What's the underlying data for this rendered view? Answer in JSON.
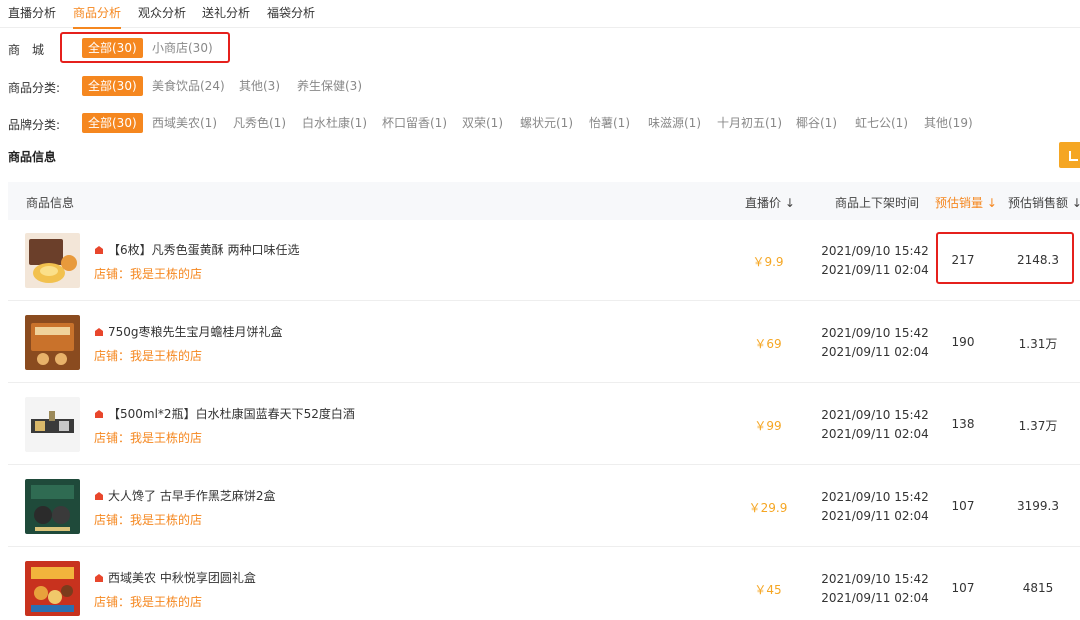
{
  "tabs": [
    {
      "label": "直播分析",
      "active": false
    },
    {
      "label": "商品分析",
      "active": true
    },
    {
      "label": "观众分析",
      "active": false
    },
    {
      "label": "送礼分析",
      "active": false
    },
    {
      "label": "福袋分析",
      "active": false
    }
  ],
  "filters": {
    "mall": {
      "label": "商　城",
      "chips": [
        "全部(30)",
        "小商店(30)"
      ]
    },
    "category": {
      "label": "商品分类:",
      "chips": [
        "全部(30)",
        "美食饮品(24)",
        "其他(3)",
        "养生保健(3)"
      ]
    },
    "brand": {
      "label": "品牌分类:",
      "chips": [
        "全部(30)",
        "西域美农(1)",
        "凡秀色(1)",
        "白水杜康(1)",
        "杯口留香(1)",
        "双荣(1)",
        "螺状元(1)",
        "怡薯(1)",
        "味滋源(1)",
        "十月初五(1)",
        "椰谷(1)",
        "虹七公(1)",
        "其他(19)"
      ]
    }
  },
  "section_title": "商品信息",
  "table": {
    "headers": {
      "info": "商品信息",
      "price": "直播价 ↓",
      "time": "商品上下架时间",
      "sales": "预估销量 ↓",
      "amount": "预估销售额 ↓"
    },
    "rows": [
      {
        "title": "【6枚】凡秀色蛋黄酥 两种口味任选",
        "shop": "店铺：我是王栋的店",
        "price": "￥9.9",
        "time_on": "2021/09/10 15:42",
        "time_off": "2021/09/11 02:04",
        "sales": "217",
        "amount": "2148.3"
      },
      {
        "title": "750g枣粮先生宝月蟾桂月饼礼盒",
        "shop": "店铺：我是王栋的店",
        "price": "￥69",
        "time_on": "2021/09/10 15:42",
        "time_off": "2021/09/11 02:04",
        "sales": "190",
        "amount": "1.31万"
      },
      {
        "title": "【500ml*2瓶】白水杜康国蓝春天下52度白酒",
        "shop": "店铺：我是王栋的店",
        "price": "￥99",
        "time_on": "2021/09/10 15:42",
        "time_off": "2021/09/11 02:04",
        "sales": "138",
        "amount": "1.37万"
      },
      {
        "title": "大人馋了 古早手作黑芝麻饼2盒",
        "shop": "店铺：我是王栋的店",
        "price": "￥29.9",
        "time_on": "2021/09/10 15:42",
        "time_off": "2021/09/11 02:04",
        "sales": "107",
        "amount": "3199.3"
      },
      {
        "title": "西域美农 中秋悦享团圆礼盒",
        "shop": "店铺：我是王栋的店",
        "price": "￥45",
        "time_on": "2021/09/10 15:42",
        "time_off": "2021/09/11 02:04",
        "sales": "107",
        "amount": "4815"
      }
    ]
  },
  "colors": {
    "accent": "#f5871f",
    "highlight_box": "#e5201c",
    "price": "#f5a623"
  }
}
